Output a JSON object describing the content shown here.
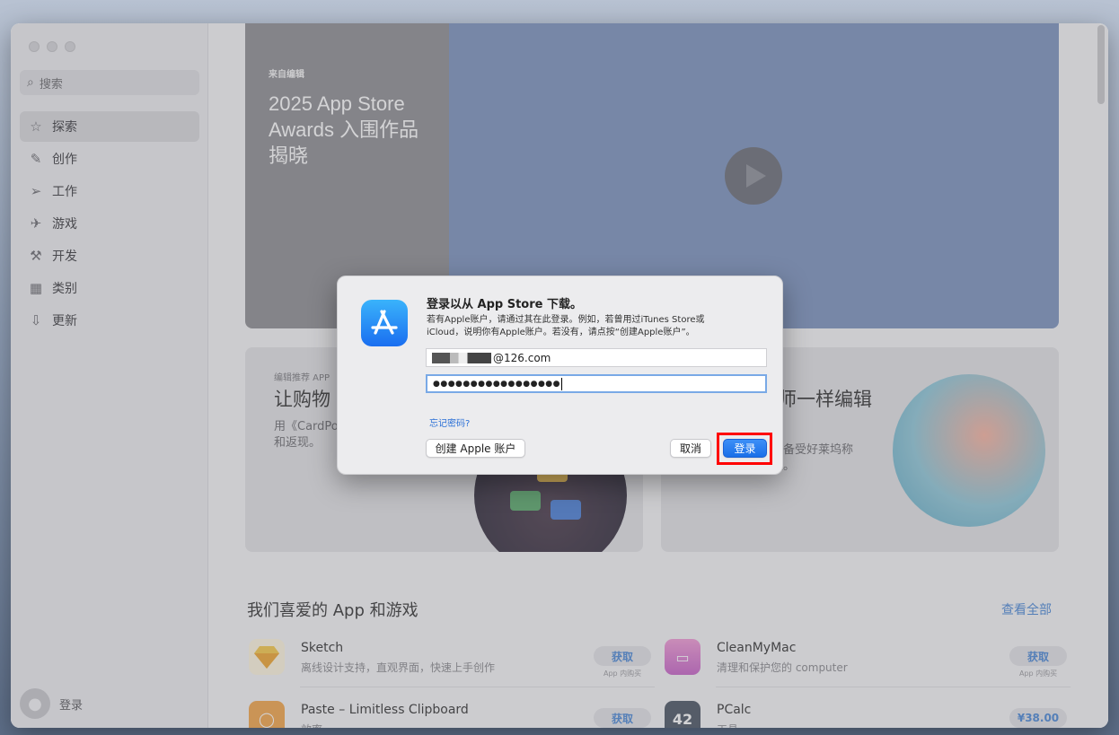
{
  "sidebar": {
    "search_placeholder": "搜索",
    "items": [
      {
        "label": "探索",
        "icon": "star-icon"
      },
      {
        "label": "创作",
        "icon": "brush-icon"
      },
      {
        "label": "工作",
        "icon": "paperplane-icon"
      },
      {
        "label": "游戏",
        "icon": "rocket-icon"
      },
      {
        "label": "开发",
        "icon": "hammer-icon"
      },
      {
        "label": "类别",
        "icon": "grid-icon"
      },
      {
        "label": "更新",
        "icon": "download-icon"
      }
    ],
    "account_label": "登录"
  },
  "hero": {
    "eyebrow": "来自编辑",
    "title": "2025 App Store Awards 入围作品揭晓"
  },
  "cards": [
    {
      "eyebrow": "编辑推荐 APP",
      "title": "让购物",
      "desc": "用《CardPo\n和返现。"
    },
    {
      "title": "师一样编辑",
      "desc": "》集备受好莱坞称\n一处。"
    }
  ],
  "section": {
    "title": "我们喜爱的 App 和游戏",
    "see_all": "查看全部"
  },
  "apps": [
    {
      "name": "Sketch",
      "sub": "离线设计支持，直观界面，快速上手创作",
      "button": "获取",
      "iap": "App 内购买"
    },
    {
      "name": "CleanMyMac",
      "sub": "清理和保护您的 computer",
      "button": "获取",
      "iap": "App 内购买"
    },
    {
      "name": "Paste – Limitless Clipboard",
      "sub": "效率",
      "button": "获取"
    },
    {
      "name": "PCalc",
      "sub": "工具",
      "button": "¥38.00",
      "icon_text": "42"
    }
  ],
  "dialog": {
    "title": "登录以从 App Store 下载。",
    "message": "若有Apple账户，请通过其在此登录。例如，若曾用过iTunes Store或iCloud，说明你有Apple账户。若没有，请点按“创建Apple账户”。",
    "email_suffix": "@126.com",
    "password_mask": "●●●●●●●●●●●●●●●●●",
    "forgot": "忘记密码?",
    "create_button": "创建 Apple 账户",
    "cancel_button": "取消",
    "login_button": "登录"
  }
}
